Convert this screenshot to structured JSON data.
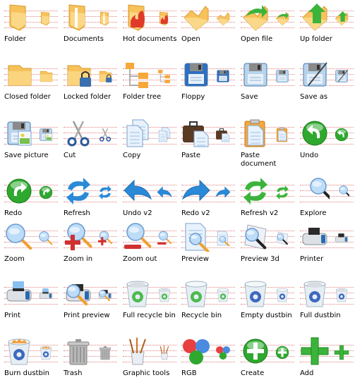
{
  "icons": [
    {
      "label": "Folder",
      "icon": "folder-icon",
      "color": "#f7c25a",
      "kind": "folder"
    },
    {
      "label": "Documents",
      "icon": "documents-folder-icon",
      "color": "#f7c25a",
      "kind": "folder-docs"
    },
    {
      "label": "Hot documents",
      "icon": "hot-documents-icon",
      "color": "#e03a2a",
      "kind": "folder-fire"
    },
    {
      "label": "Open",
      "icon": "open-folder-icon",
      "color": "#f7c25a",
      "kind": "open"
    },
    {
      "label": "Open file",
      "icon": "open-file-icon",
      "color": "#3cb43c",
      "kind": "open-arrow"
    },
    {
      "label": "Up folder",
      "icon": "up-folder-icon",
      "color": "#3cb43c",
      "kind": "open-up"
    },
    {
      "label": "Closed folder",
      "icon": "closed-folder-icon",
      "color": "#f7c25a",
      "kind": "closed"
    },
    {
      "label": "Locked folder",
      "icon": "locked-folder-icon",
      "color": "#3a6fb0",
      "kind": "closed-lock"
    },
    {
      "label": "Folder tree",
      "icon": "folder-tree-icon",
      "color": "#f7a83a",
      "kind": "tree"
    },
    {
      "label": "Floppy",
      "icon": "floppy-icon",
      "color": "#2d6fc0",
      "kind": "floppy"
    },
    {
      "label": "Save",
      "icon": "save-icon",
      "color": "#8ab4d8",
      "kind": "save"
    },
    {
      "label": "Save as",
      "icon": "save-as-icon",
      "color": "#8ab4d8",
      "kind": "save-as"
    },
    {
      "label": "Save picture",
      "icon": "save-picture-icon",
      "color": "#8ab4d8",
      "kind": "save-pic"
    },
    {
      "label": "Cut",
      "icon": "scissors-icon",
      "color": "#2a5a9a",
      "kind": "cut"
    },
    {
      "label": "Copy",
      "icon": "copy-icon",
      "color": "#b8d4f0",
      "kind": "copy"
    },
    {
      "label": "Paste",
      "icon": "paste-icon",
      "color": "#5a3a22",
      "kind": "paste"
    },
    {
      "label": "Paste document",
      "icon": "paste-document-icon",
      "color": "#f7a83a",
      "kind": "paste-doc"
    },
    {
      "label": "Undo",
      "icon": "undo-icon",
      "color": "#2ea82e",
      "kind": "undo"
    },
    {
      "label": "Redo",
      "icon": "redo-icon",
      "color": "#2ea82e",
      "kind": "redo"
    },
    {
      "label": "Refresh",
      "icon": "refresh-icon",
      "color": "#2a8ad8",
      "kind": "refresh"
    },
    {
      "label": "Undo v2",
      "icon": "undo-v2-icon",
      "color": "#2a8ad8",
      "kind": "undo2"
    },
    {
      "label": "Redo v2",
      "icon": "redo-v2-icon",
      "color": "#2a8ad8",
      "kind": "redo2"
    },
    {
      "label": "Refresh v2",
      "icon": "refresh-v2-icon",
      "color": "#3cb43c",
      "kind": "refresh2"
    },
    {
      "label": "Explore",
      "icon": "magnifier-icon",
      "color": "#9ac8ec",
      "kind": "explore"
    },
    {
      "label": "Zoom",
      "icon": "zoom-icon",
      "color": "#8ab8ec",
      "kind": "zoom"
    },
    {
      "label": "Zoom in",
      "icon": "zoom-in-icon",
      "color": "#d03030",
      "kind": "zoom-in"
    },
    {
      "label": "Zoom out",
      "icon": "zoom-out-icon",
      "color": "#d03030",
      "kind": "zoom-out"
    },
    {
      "label": "Preview",
      "icon": "preview-icon",
      "color": "#b8d4f0",
      "kind": "preview"
    },
    {
      "label": "Preview 3d",
      "icon": "preview-3d-icon",
      "color": "#6a9ad8",
      "kind": "preview3d"
    },
    {
      "label": "Printer",
      "icon": "printer-icon",
      "color": "#d0d4d8",
      "kind": "printer"
    },
    {
      "label": "Print",
      "icon": "print-icon",
      "color": "#d0d4d8",
      "kind": "print"
    },
    {
      "label": "Print preview",
      "icon": "print-preview-icon",
      "color": "#d0d4d8",
      "kind": "print-preview"
    },
    {
      "label": "Full recycle bin",
      "icon": "full-recycle-bin-icon",
      "color": "#3cb43c",
      "kind": "bin-green-full"
    },
    {
      "label": "Recycle bin",
      "icon": "recycle-bin-icon",
      "color": "#3cb43c",
      "kind": "bin-green"
    },
    {
      "label": "Empty dustbin",
      "icon": "empty-dustbin-icon",
      "color": "#2a5ab8",
      "kind": "bin-blue"
    },
    {
      "label": "Full dustbin",
      "icon": "full-dustbin-icon",
      "color": "#2a5ab8",
      "kind": "bin-blue-full"
    },
    {
      "label": "Burn dustbin",
      "icon": "burn-dustbin-icon",
      "color": "#f09a3a",
      "kind": "bin-burn"
    },
    {
      "label": "Trash",
      "icon": "trash-can-icon",
      "color": "#a8a8a8",
      "kind": "trash"
    },
    {
      "label": "Graphic tools",
      "icon": "graphic-tools-icon",
      "color": "#e0902a",
      "kind": "brushes"
    },
    {
      "label": "RGB",
      "icon": "rgb-icon",
      "color": "#e03030",
      "kind": "rgb"
    },
    {
      "label": "Create",
      "icon": "create-icon",
      "color": "#2ea82e",
      "kind": "create"
    },
    {
      "label": "Add",
      "icon": "add-icon",
      "color": "#2ea82e",
      "kind": "add"
    }
  ]
}
